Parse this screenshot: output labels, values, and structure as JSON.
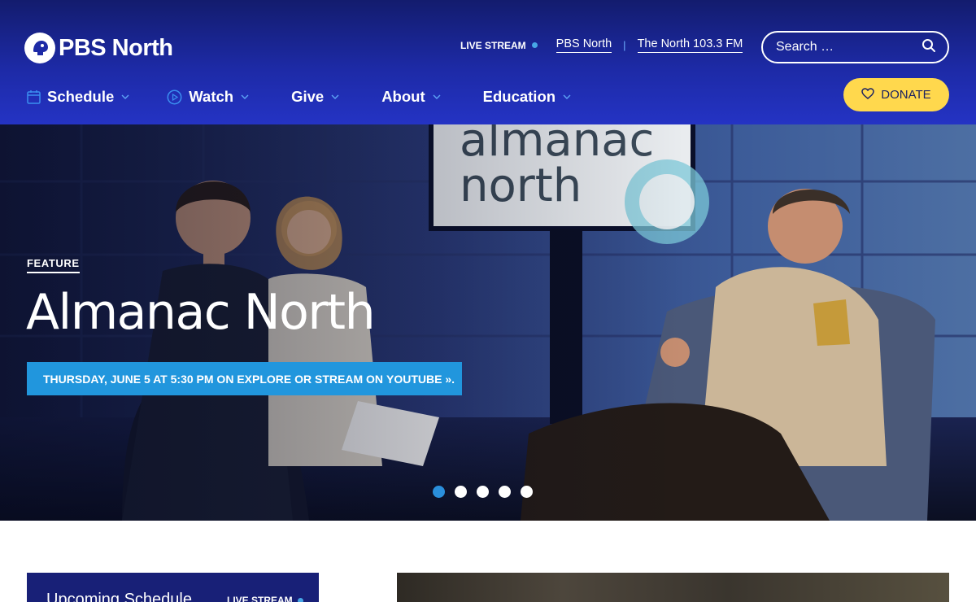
{
  "site": {
    "logo_text": "PBS North",
    "logo_icon": "pbs-head-icon"
  },
  "top_links": {
    "live_stream": "LIVE STREAM",
    "pbs_north": "PBS North",
    "separator": "|",
    "radio": "The North 103.3 FM"
  },
  "search": {
    "placeholder": "Search …",
    "icon": "search-icon"
  },
  "nav": {
    "items": [
      {
        "label": "Schedule",
        "icon": "calendar-icon"
      },
      {
        "label": "Watch",
        "icon": "play-circle-icon"
      },
      {
        "label": "Give"
      },
      {
        "label": "About"
      },
      {
        "label": "Education"
      }
    ]
  },
  "donate": {
    "label": "DONATE",
    "icon": "heart-icon"
  },
  "hero": {
    "eyebrow": "FEATURE",
    "title": "Almanac North",
    "cta_text": "THURSDAY, JUNE 5 AT 5:30 PM ON EXPLORE OR STREAM ON",
    "cta_link": "YOUTUBE ».",
    "backdrop_sign_line1": "almanac",
    "backdrop_sign_line2": "north",
    "slides_total": 5,
    "active_slide": 1
  },
  "schedule_card": {
    "title": "Upcoming Schedule",
    "live": "LIVE STREAM"
  },
  "colors": {
    "header_top": "#131c6e",
    "header_bottom": "#2433c4",
    "accent_blue": "#2196dd",
    "donate_yellow": "#ffd84d",
    "live_dot": "#47a6e6"
  }
}
